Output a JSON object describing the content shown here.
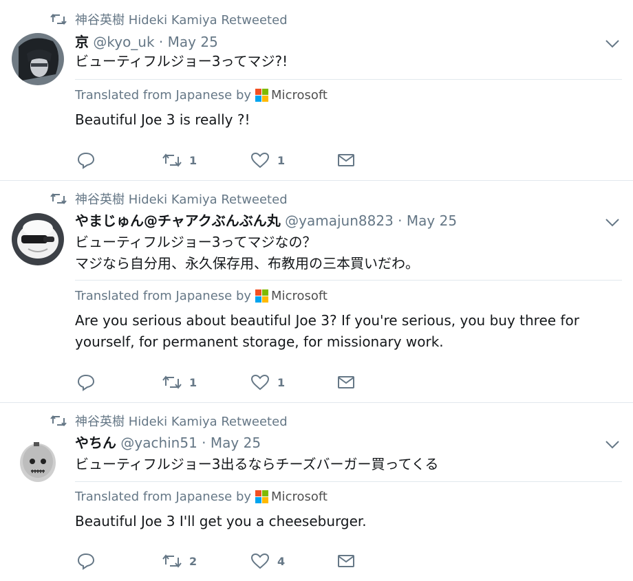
{
  "retweet_context": "神谷英樹 Hideki Kamiya Retweeted",
  "translated_from": "Translated from Japanese by",
  "microsoft_label": "Microsoft",
  "microsoft_colors": [
    "#f25022",
    "#7fba00",
    "#00a4ef",
    "#ffb900"
  ],
  "tweets": [
    {
      "name": "京",
      "handle": "@kyo_uk",
      "separator": "·",
      "time": "May 25",
      "text_lines": [
        "ビューティフルジョー3ってマジ?!"
      ],
      "translation": "Beautiful Joe 3 is really ?!",
      "reply_count": "",
      "retweet_count": "1",
      "like_count": "1"
    },
    {
      "name": "やまじゅん@チャアクぶんぶん丸",
      "handle": "@yamajun8823",
      "separator": "·",
      "time": "May 25",
      "text_lines": [
        "ビューティフルジョー3ってマジなの？",
        "マジなら自分用、永久保存用、布教用の三本買いだわ。"
      ],
      "translation": "Are you serious about beautiful Joe 3? If you're serious, you buy three for yourself, for permanent storage, for missionary work.",
      "reply_count": "",
      "retweet_count": "1",
      "like_count": "1"
    },
    {
      "name": "やちん",
      "handle": "@yachin51",
      "separator": "·",
      "time": "May 25",
      "text_lines": [
        "ビューティフルジョー3出るならチーズバーガー買ってくる"
      ],
      "translation": "Beautiful Joe 3 I'll get you a cheeseburger.",
      "reply_count": "",
      "retweet_count": "2",
      "like_count": "4"
    }
  ]
}
